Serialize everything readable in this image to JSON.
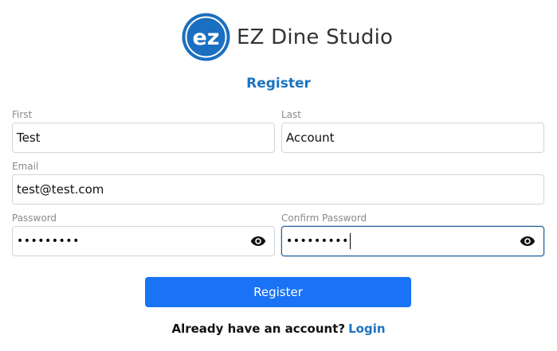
{
  "brand": {
    "logo_text": "ez",
    "name": "EZ Dine Studio",
    "logo_color": "#1a6fc0"
  },
  "form": {
    "heading": "Register",
    "first": {
      "label": "First",
      "value": "Test"
    },
    "last": {
      "label": "Last",
      "value": "Account"
    },
    "email": {
      "label": "Email",
      "value": "test@test.com"
    },
    "password": {
      "label": "Password",
      "value": "•••••••••",
      "icon": "eye-icon"
    },
    "confirm_password": {
      "label": "Confirm Password",
      "value": "•••••••••",
      "icon": "eye-icon"
    },
    "submit_label": "Register"
  },
  "footer": {
    "prompt": "Already have an account?",
    "login_label": "Login"
  },
  "colors": {
    "accent": "#1a73c1",
    "button": "#1a73f5"
  }
}
